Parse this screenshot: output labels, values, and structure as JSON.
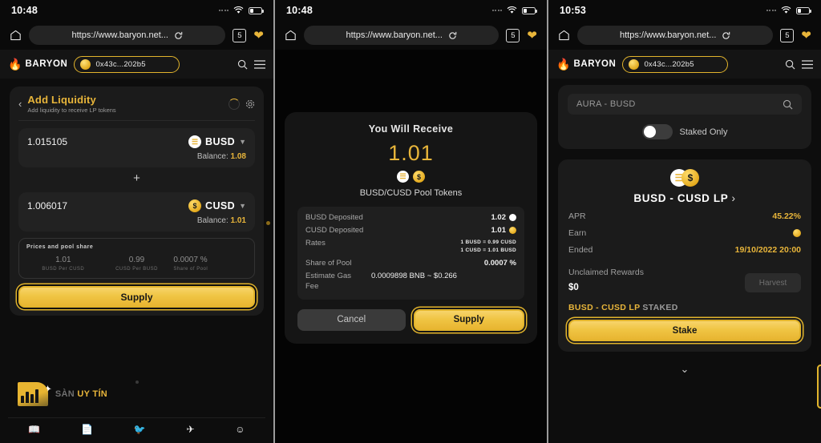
{
  "panels": [
    {
      "status": {
        "time": "10:48",
        "wifi_icon": "wifi-icon",
        "battery_icon": "battery-icon"
      },
      "browser": {
        "home_icon": "home-icon",
        "url": "https://www.baryon.net...",
        "reload_icon": "reload-icon",
        "tab_count": "5",
        "bookmark_icon": "heart-icon"
      },
      "app_header": {
        "brand": "BARYON",
        "flame_icon": "flame-icon",
        "address": "0x43c...202b5",
        "search_icon": "search-icon",
        "menu_icon": "hamburger-icon"
      },
      "add_liquidity": {
        "back_icon": "chevron-left-icon",
        "title": "Add Liquidity",
        "subtitle": "Add liquidity to receive LP tokens",
        "refresh_icon": "loading-spinner-icon",
        "settings_icon": "gear-icon",
        "token_a": {
          "amount": "1.015105",
          "symbol": "BUSD",
          "balance_label": "Balance:",
          "balance": "1.08",
          "icon": "busd-coin-icon"
        },
        "plus_icon": "plus-icon",
        "token_b": {
          "amount": "1.006017",
          "symbol": "CUSD",
          "balance_label": "Balance:",
          "balance": "1.01",
          "icon": "cusd-coin-icon"
        },
        "pool": {
          "title": "Prices and pool share",
          "cells": [
            {
              "value": "1.01",
              "label": "BUSD Per CUSD"
            },
            {
              "value": "0.99",
              "label": "CUSD Per BUSD"
            },
            {
              "value": "0.0007 %",
              "label": "Share of Pool"
            }
          ]
        },
        "supply_button": "Supply"
      },
      "watermark": {
        "text_a": "SÀN ",
        "text_b": "UY TÍN"
      },
      "social": [
        "book-icon",
        "document-icon",
        "twitter-icon",
        "telegram-icon",
        "discord-icon"
      ]
    },
    {
      "status": {
        "time": "10:48"
      },
      "browser": {
        "url": "https://www.baryon.net...",
        "tab_count": "5"
      },
      "modal": {
        "title": "You Will Receive",
        "amount": "1.01",
        "pool_tokens": "BUSD/CUSD Pool Tokens",
        "rows": [
          {
            "key": "BUSD Deposited",
            "value": "1.02",
            "icon": "busd-coin-icon"
          },
          {
            "key": "CUSD Deposited",
            "value": "1.01",
            "icon": "cusd-coin-icon"
          }
        ],
        "rates_key": "Rates",
        "rates": [
          "1 BUSD = 0.99 CUSD",
          "1 CUSD = 1.01 BUSD"
        ],
        "share_key": "Share of Pool",
        "share_value": "0.0007 %",
        "gas_key": "Estimate Gas Fee",
        "gas_value": "0.0009898 BNB ~ $0.266",
        "cancel_button": "Cancel",
        "supply_button": "Supply"
      }
    },
    {
      "status": {
        "time": "10:53"
      },
      "browser": {
        "url": "https://www.baryon.net...",
        "tab_count": "5"
      },
      "app_header": {
        "brand": "BARYON",
        "address": "0x43c...202b5"
      },
      "search": {
        "value": "AURA - BUSD",
        "search_icon": "search-icon"
      },
      "toggle": {
        "label": "Staked Only",
        "state": "off"
      },
      "farm": {
        "title": "BUSD - CUSD LP",
        "title_chevron": "›",
        "rows": [
          {
            "key": "APR",
            "value": "45.22%"
          },
          {
            "key": "Earn",
            "value": "",
            "icon": "token-coin-icon"
          },
          {
            "key": "Ended",
            "value": "19/10/2022 20:00"
          }
        ],
        "unclaimed_label": "Unclaimed Rewards",
        "unclaimed_value": "$0",
        "harvest_button": "Harvest",
        "staked_pair": "BUSD - CUSD LP",
        "staked_suffix": " STAKED",
        "stake_button": "Stake",
        "expand_icon": "chevron-down-icon"
      }
    }
  ],
  "colors": {
    "accent": "#e8b53a",
    "button": "#f0c544",
    "panel": "#1b1b1b",
    "background": "#0d0d0d"
  }
}
